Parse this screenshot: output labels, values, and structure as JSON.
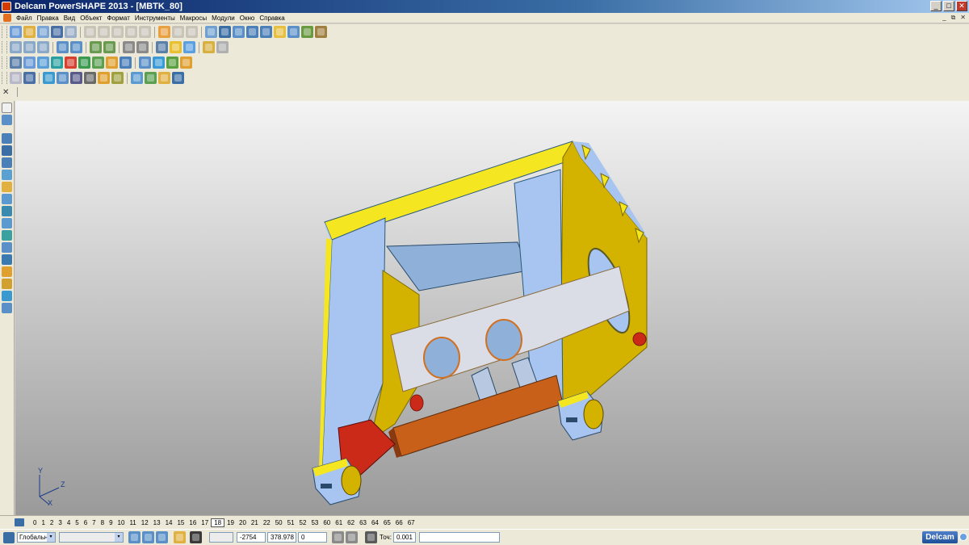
{
  "window": {
    "title": "Delcam PowerSHAPE 2013 - [MBTK_80]",
    "minimize": "_",
    "maximize": "□",
    "close": "✕"
  },
  "menu": [
    "Файл",
    "Правка",
    "Вид",
    "Объект",
    "Формат",
    "Инструменты",
    "Макросы",
    "Модули",
    "Окно",
    "Справка"
  ],
  "mdi_controls": {
    "minimize": "_",
    "restore": "⧉",
    "close": "✕"
  },
  "toolbar": {
    "close_glyph": "✕",
    "dropdown_glyph": "▾"
  },
  "levels": {
    "items": [
      "0",
      "1",
      "2",
      "3",
      "4",
      "5",
      "6",
      "7",
      "8",
      "9",
      "10",
      "11",
      "12",
      "13",
      "14",
      "15",
      "16",
      "17",
      "18",
      "19",
      "20",
      "21",
      "22",
      "50",
      "51",
      "52",
      "53",
      "60",
      "61",
      "62",
      "63",
      "64",
      "65",
      "66",
      "67"
    ],
    "active": "18"
  },
  "status": {
    "workplane": "Глобальна",
    "second_select": "",
    "x": "-2754",
    "y": "378.978",
    "z": "0",
    "tolerance_label": "Точ:",
    "tolerance": "0.001",
    "info_field": "",
    "logo": "Delcam"
  },
  "axes": {
    "y": "Y",
    "z": "Z",
    "x": "X"
  },
  "colors": {
    "accent": "#3a6ea5",
    "frame_yellow": "#f5e622",
    "frame_blue": "#a7c5f0",
    "frame_dark_yellow": "#d4b300",
    "plate_orange": "#c8601a",
    "red_part": "#cc2a18"
  }
}
